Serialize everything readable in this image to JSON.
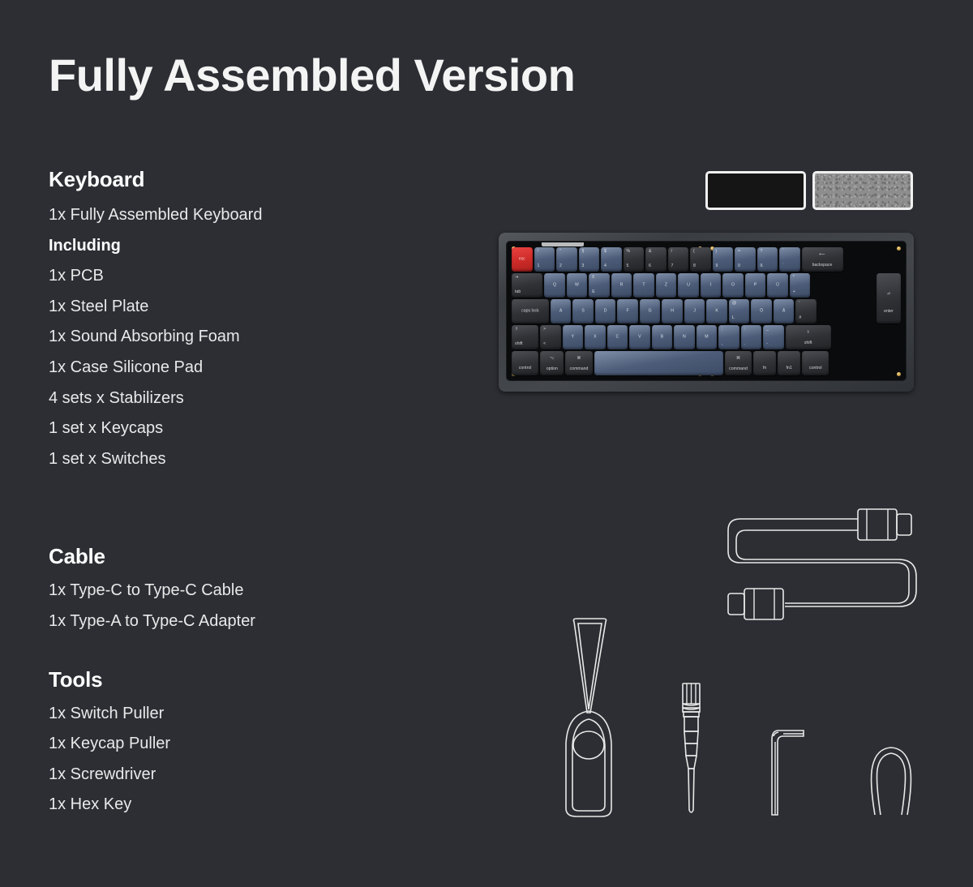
{
  "title": "Fully Assembled Version",
  "sections": [
    {
      "heading": "Keyboard",
      "items": [
        {
          "text": "1x Fully Assembled Keyboard",
          "bold": false
        },
        {
          "text": "Including",
          "bold": true
        },
        {
          "text": "1x PCB",
          "bold": false
        },
        {
          "text": "1x Steel Plate",
          "bold": false
        },
        {
          "text": "1x Sound Absorbing Foam",
          "bold": false
        },
        {
          "text": "1x Case Silicone Pad",
          "bold": false
        },
        {
          "text": "4 sets x Stabilizers",
          "bold": false
        },
        {
          "text": "1 set x Keycaps",
          "bold": false
        },
        {
          "text": "1 set x Switches",
          "bold": false
        }
      ]
    },
    {
      "heading": "Cable",
      "items": [
        {
          "text": "1x Type-C to Type-C Cable",
          "bold": false
        },
        {
          "text": "1x Type-A to Type-C Adapter",
          "bold": false
        }
      ]
    },
    {
      "heading": "Tools",
      "items": [
        {
          "text": "1x Switch Puller",
          "bold": false
        },
        {
          "text": "1x Keycap Puller",
          "bold": false
        },
        {
          "text": "1x Screwdriver",
          "bold": false
        },
        {
          "text": "1x Hex Key",
          "bold": false
        }
      ]
    }
  ],
  "swatches": [
    {
      "name": "case-silicone-pad-swatch",
      "color": "#151515"
    },
    {
      "name": "sound-absorbing-foam-swatch",
      "color": "#8d8d8d"
    }
  ],
  "colors": {
    "background": "#2c2e33",
    "text": "#e9e9ea",
    "heading": "#ffffff",
    "keycap_blue": "#4d5d79",
    "keycap_dark": "#303236",
    "escape_red": "#cd2b28",
    "line_art": "#e8e8e8"
  },
  "keyboard": {
    "layout": "65% ISO German (QWERTZ)",
    "rows": [
      [
        {
          "label": "esc",
          "color": "red",
          "w": 1,
          "style": "mid"
        },
        {
          "top": "!",
          "bottom": "1",
          "color": "blue",
          "w": 1
        },
        {
          "top": "\"",
          "bottom": "2",
          "color": "blue",
          "w": 1
        },
        {
          "top": "§",
          "bottom": "3",
          "color": "blue",
          "w": 1
        },
        {
          "top": "$",
          "bottom": "4",
          "color": "blue",
          "w": 1
        },
        {
          "top": "%",
          "bottom": "5",
          "color": "dark",
          "w": 1
        },
        {
          "top": "&",
          "bottom": "6",
          "color": "dark",
          "w": 1
        },
        {
          "top": "/",
          "bottom": "7",
          "color": "dark",
          "w": 1
        },
        {
          "top": "(",
          "bottom": "8",
          "color": "dark",
          "w": 1
        },
        {
          "top": ")",
          "bottom": "9",
          "color": "blue",
          "w": 1
        },
        {
          "top": "=",
          "bottom": "0",
          "color": "blue",
          "w": 1
        },
        {
          "top": "?",
          "bottom": "ß",
          "color": "blue",
          "w": 1
        },
        {
          "top": "`",
          "bottom": "´",
          "color": "blue",
          "w": 1
        },
        {
          "top": "⟵",
          "bottom": "backspace",
          "color": "dark",
          "w": 2,
          "style": "stack"
        }
      ],
      [
        {
          "top": "⇥",
          "bottom": "tab",
          "color": "dark",
          "w": 1.5,
          "style": "stack-left"
        },
        {
          "label": "Q",
          "color": "blue",
          "w": 1,
          "style": "mid"
        },
        {
          "label": "W",
          "color": "blue",
          "w": 1,
          "style": "mid"
        },
        {
          "top": "€",
          "bottom": "E",
          "color": "blue",
          "w": 1
        },
        {
          "label": "R",
          "color": "blue",
          "w": 1,
          "style": "mid"
        },
        {
          "label": "T",
          "color": "blue",
          "w": 1,
          "style": "mid"
        },
        {
          "label": "Z",
          "color": "blue",
          "w": 1,
          "style": "mid"
        },
        {
          "label": "U",
          "color": "blue",
          "w": 1,
          "style": "mid"
        },
        {
          "label": "I",
          "color": "blue",
          "w": 1,
          "style": "mid"
        },
        {
          "label": "O",
          "color": "blue",
          "w": 1,
          "style": "mid"
        },
        {
          "label": "P",
          "color": "blue",
          "w": 1,
          "style": "mid"
        },
        {
          "label": "Ü",
          "color": "blue",
          "w": 1,
          "style": "mid"
        },
        {
          "top": "*",
          "bottom": "+",
          "color": "blue",
          "w": 1
        }
      ],
      [
        {
          "label": "caps lock",
          "color": "dark",
          "w": 1.8,
          "style": "mid"
        },
        {
          "label": "A",
          "color": "blue",
          "w": 1,
          "style": "mid"
        },
        {
          "label": "S",
          "color": "blue",
          "w": 1,
          "style": "mid"
        },
        {
          "label": "D",
          "color": "blue",
          "w": 1,
          "style": "mid"
        },
        {
          "label": "F",
          "color": "blue",
          "w": 1,
          "style": "mid"
        },
        {
          "label": "G",
          "color": "blue",
          "w": 1,
          "style": "mid"
        },
        {
          "label": "H",
          "color": "blue",
          "w": 1,
          "style": "mid"
        },
        {
          "label": "J",
          "color": "blue",
          "w": 1,
          "style": "mid"
        },
        {
          "label": "K",
          "color": "blue",
          "w": 1,
          "style": "mid"
        },
        {
          "top": "@",
          "bottom": "L",
          "color": "blue",
          "w": 1
        },
        {
          "label": "Ö",
          "color": "blue",
          "w": 1,
          "style": "mid"
        },
        {
          "label": "Ä",
          "color": "blue",
          "w": 1,
          "style": "mid"
        },
        {
          "top": "'",
          "bottom": "#",
          "color": "dark",
          "w": 1
        }
      ],
      [
        {
          "top": "⇧",
          "bottom": "shift",
          "color": "dark",
          "w": 1.3,
          "style": "stack-left"
        },
        {
          "top": ">",
          "bottom": "<",
          "color": "dark",
          "w": 1
        },
        {
          "label": "Y",
          "color": "blue",
          "w": 1,
          "style": "mid"
        },
        {
          "label": "X",
          "color": "blue",
          "w": 1,
          "style": "mid"
        },
        {
          "label": "C",
          "color": "blue",
          "w": 1,
          "style": "mid"
        },
        {
          "label": "V",
          "color": "blue",
          "w": 1,
          "style": "mid"
        },
        {
          "label": "B",
          "color": "blue",
          "w": 1,
          "style": "mid"
        },
        {
          "label": "N",
          "color": "blue",
          "w": 1,
          "style": "mid"
        },
        {
          "label": "M",
          "color": "blue",
          "w": 1,
          "style": "mid"
        },
        {
          "top": ";",
          "bottom": ",",
          "color": "blue",
          "w": 1
        },
        {
          "top": ":",
          "bottom": ".",
          "color": "blue",
          "w": 1
        },
        {
          "top": "_",
          "bottom": "-",
          "color": "blue",
          "w": 1
        },
        {
          "top": "⇧",
          "bottom": "shift",
          "color": "dark",
          "w": 2.2,
          "style": "stack"
        }
      ],
      [
        {
          "label": "control",
          "color": "dark",
          "w": 1.3,
          "style": "bot"
        },
        {
          "top": "⌥",
          "bottom": "option",
          "color": "dark",
          "w": 1.15,
          "style": "stack"
        },
        {
          "top": "⌘",
          "bottom": "command",
          "color": "dark",
          "w": 1.3,
          "style": "stack"
        },
        {
          "label": "",
          "color": "space",
          "w": 6.25
        },
        {
          "top": "⌘",
          "bottom": "command",
          "color": "dark",
          "w": 1.3,
          "style": "stack"
        },
        {
          "label": "fn",
          "color": "dark",
          "w": 1.1,
          "style": "bot"
        },
        {
          "label": "fn1",
          "color": "dark",
          "w": 1.1,
          "style": "bot"
        },
        {
          "label": "control",
          "color": "dark",
          "w": 1.3,
          "style": "bot"
        }
      ]
    ],
    "enter_key": {
      "top": "⏎",
      "bottom": "enter",
      "color": "dark"
    }
  },
  "illustrations": [
    {
      "name": "usb-c-cable-illustration"
    },
    {
      "name": "switch-puller-illustration"
    },
    {
      "name": "screwdriver-illustration"
    },
    {
      "name": "hex-key-illustration"
    },
    {
      "name": "keycap-puller-illustration"
    }
  ]
}
